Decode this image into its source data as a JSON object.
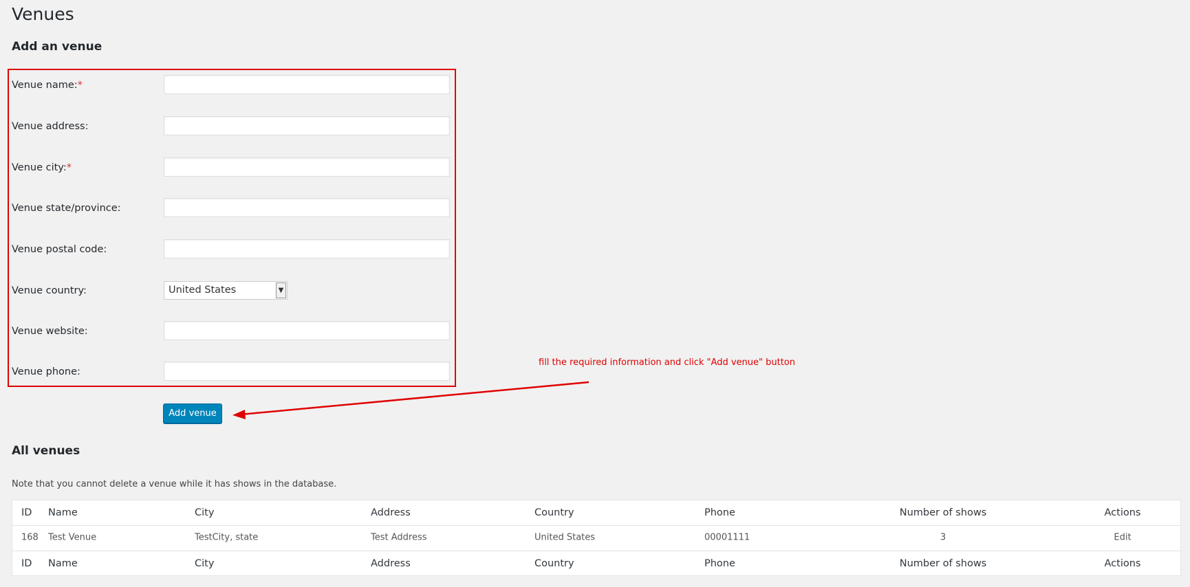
{
  "page": {
    "title": "Venues",
    "add_heading": "Add an venue",
    "all_heading": "All venues",
    "note": "Note that you cannot delete a venue while it has shows in the database."
  },
  "form": {
    "name_label": "Venue name:",
    "address_label": "Venue address:",
    "city_label": "Venue city:",
    "state_label": "Venue state/province:",
    "postal_label": "Venue postal code:",
    "country_label": "Venue country:",
    "website_label": "Venue website:",
    "phone_label": "Venue phone:",
    "required_mark": "*",
    "country_value": "United States",
    "submit_label": "Add venue"
  },
  "annotation": {
    "text": "fill the required information and click \"Add venue\" button",
    "color": "#e00000"
  },
  "table": {
    "columns": [
      "ID",
      "Name",
      "City",
      "Address",
      "Country",
      "Phone",
      "Number of shows",
      "Actions"
    ],
    "rows": [
      {
        "id": "168",
        "name": "Test Venue",
        "city": "TestCity, state",
        "address": "Test Address",
        "country": "United States",
        "phone": "00001111",
        "shows": "3",
        "action": "Edit"
      }
    ]
  },
  "colors": {
    "background": "#f1f1f1",
    "primary_button": "#0085ba",
    "link": "#0073aa",
    "required": "#dc3232"
  }
}
